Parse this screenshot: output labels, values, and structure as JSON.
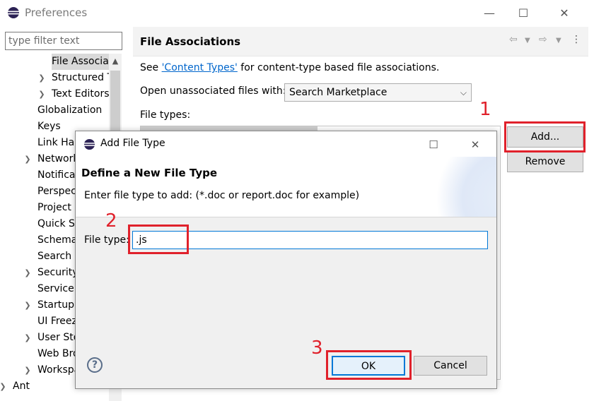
{
  "window": {
    "title": "Preferences",
    "controls": {
      "minimize": "—",
      "maximize": "☐",
      "close": "✕"
    }
  },
  "sidebar": {
    "filter_placeholder": "type filter text",
    "items": [
      {
        "label": "File Associati",
        "indent": 2,
        "arrow": "",
        "selected": true
      },
      {
        "label": "Structured T",
        "indent": 2,
        "arrow": ">"
      },
      {
        "label": "Text Editors",
        "indent": 2,
        "arrow": ">"
      },
      {
        "label": "Globalization",
        "indent": 1,
        "arrow": ""
      },
      {
        "label": "Keys",
        "indent": 1,
        "arrow": ""
      },
      {
        "label": "Link Ha",
        "indent": 1,
        "arrow": ""
      },
      {
        "label": "Network",
        "indent": 1,
        "arrow": ">"
      },
      {
        "label": "Notifica",
        "indent": 1,
        "arrow": ""
      },
      {
        "label": "Perspect",
        "indent": 1,
        "arrow": ""
      },
      {
        "label": "Project",
        "indent": 1,
        "arrow": ""
      },
      {
        "label": "Quick S",
        "indent": 1,
        "arrow": ""
      },
      {
        "label": "Schema",
        "indent": 1,
        "arrow": ""
      },
      {
        "label": "Search",
        "indent": 1,
        "arrow": ""
      },
      {
        "label": "Security",
        "indent": 1,
        "arrow": ">"
      },
      {
        "label": "Service",
        "indent": 1,
        "arrow": ""
      },
      {
        "label": "Startup",
        "indent": 1,
        "arrow": ">"
      },
      {
        "label": "UI Freez",
        "indent": 1,
        "arrow": ""
      },
      {
        "label": "User Sto",
        "indent": 1,
        "arrow": ">"
      },
      {
        "label": "Web Bro",
        "indent": 1,
        "arrow": ""
      },
      {
        "label": "Workspa",
        "indent": 1,
        "arrow": ">"
      },
      {
        "label": "Ant",
        "indent": 0,
        "arrow": ">"
      }
    ]
  },
  "content": {
    "title": "File Associations",
    "see_prefix": "See ",
    "see_link": "'Content Types'",
    "see_suffix": " for content-type based file associations.",
    "open_unassociated_label": "Open unassociated files with:",
    "open_unassociated_value": "Search Marketplace",
    "file_types_label": "File types:",
    "add_button": "Add...",
    "remove_button": "Remove"
  },
  "dialog": {
    "title": "Add File Type",
    "controls": {
      "maximize": "☐",
      "close": "✕"
    },
    "header_title": "Define a New File Type",
    "header_message": "Enter file type to add: (*.doc or report.doc for example)",
    "file_type_label": "File type:",
    "file_type_value": ".js",
    "ok_button": "OK",
    "cancel_button": "Cancel",
    "help": "?"
  },
  "annotations": {
    "step1": "1",
    "step2": "2",
    "step3": "3",
    "color": "#e0212b"
  },
  "colors": {
    "accent": "#0078d7",
    "link": "#0066cc"
  }
}
